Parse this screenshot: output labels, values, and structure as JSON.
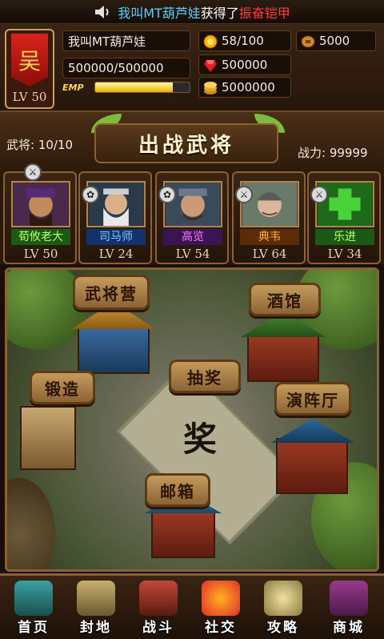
{
  "notice": {
    "user": "我叫MT葫芦娃",
    "verb": "获得了",
    "item": "振奋铠甲",
    "icon": "speaker-icon"
  },
  "player": {
    "level": "LV 50",
    "name": "我叫MT葫芦娃",
    "hp": "500000/500000",
    "emp_label": "EMP",
    "emp_fill_fraction": 0.82,
    "stamina": "58/100",
    "coins": "5000",
    "gems": "500000",
    "gold": "5000000"
  },
  "generals_header": {
    "count_label": "武将: 10/10",
    "title": "出战武将",
    "power_label": "战力: 99999"
  },
  "generals": [
    {
      "name": "荀攸老大",
      "level": "LV 50",
      "badge": "sword-icon",
      "name_color": "green"
    },
    {
      "name": "司马师",
      "level": "LV 24",
      "badge": "paw-icon",
      "name_color": "blue"
    },
    {
      "name": "高览",
      "level": "LV 54",
      "badge": "paw-icon",
      "name_color": "purple"
    },
    {
      "name": "典韦",
      "level": "LV 64",
      "badge": "sword-icon",
      "name_color": "orange"
    },
    {
      "name": "乐进",
      "level": "LV 34",
      "badge": "sword-icon",
      "name_color": "green"
    }
  ],
  "town": {
    "barracks": "武将营",
    "tavern": "酒馆",
    "forge": "锻造",
    "lottery": "抽奖",
    "formation": "演阵厅",
    "mailbox": "邮箱",
    "prize_char": "奖"
  },
  "nav": [
    {
      "label": "首页",
      "icon": "home-icon"
    },
    {
      "label": "封地",
      "icon": "fief-icon"
    },
    {
      "label": "战斗",
      "icon": "battle-icon"
    },
    {
      "label": "社交",
      "icon": "social-icon"
    },
    {
      "label": "攻略",
      "icon": "guide-icon"
    },
    {
      "label": "商城",
      "icon": "shop-icon"
    }
  ]
}
